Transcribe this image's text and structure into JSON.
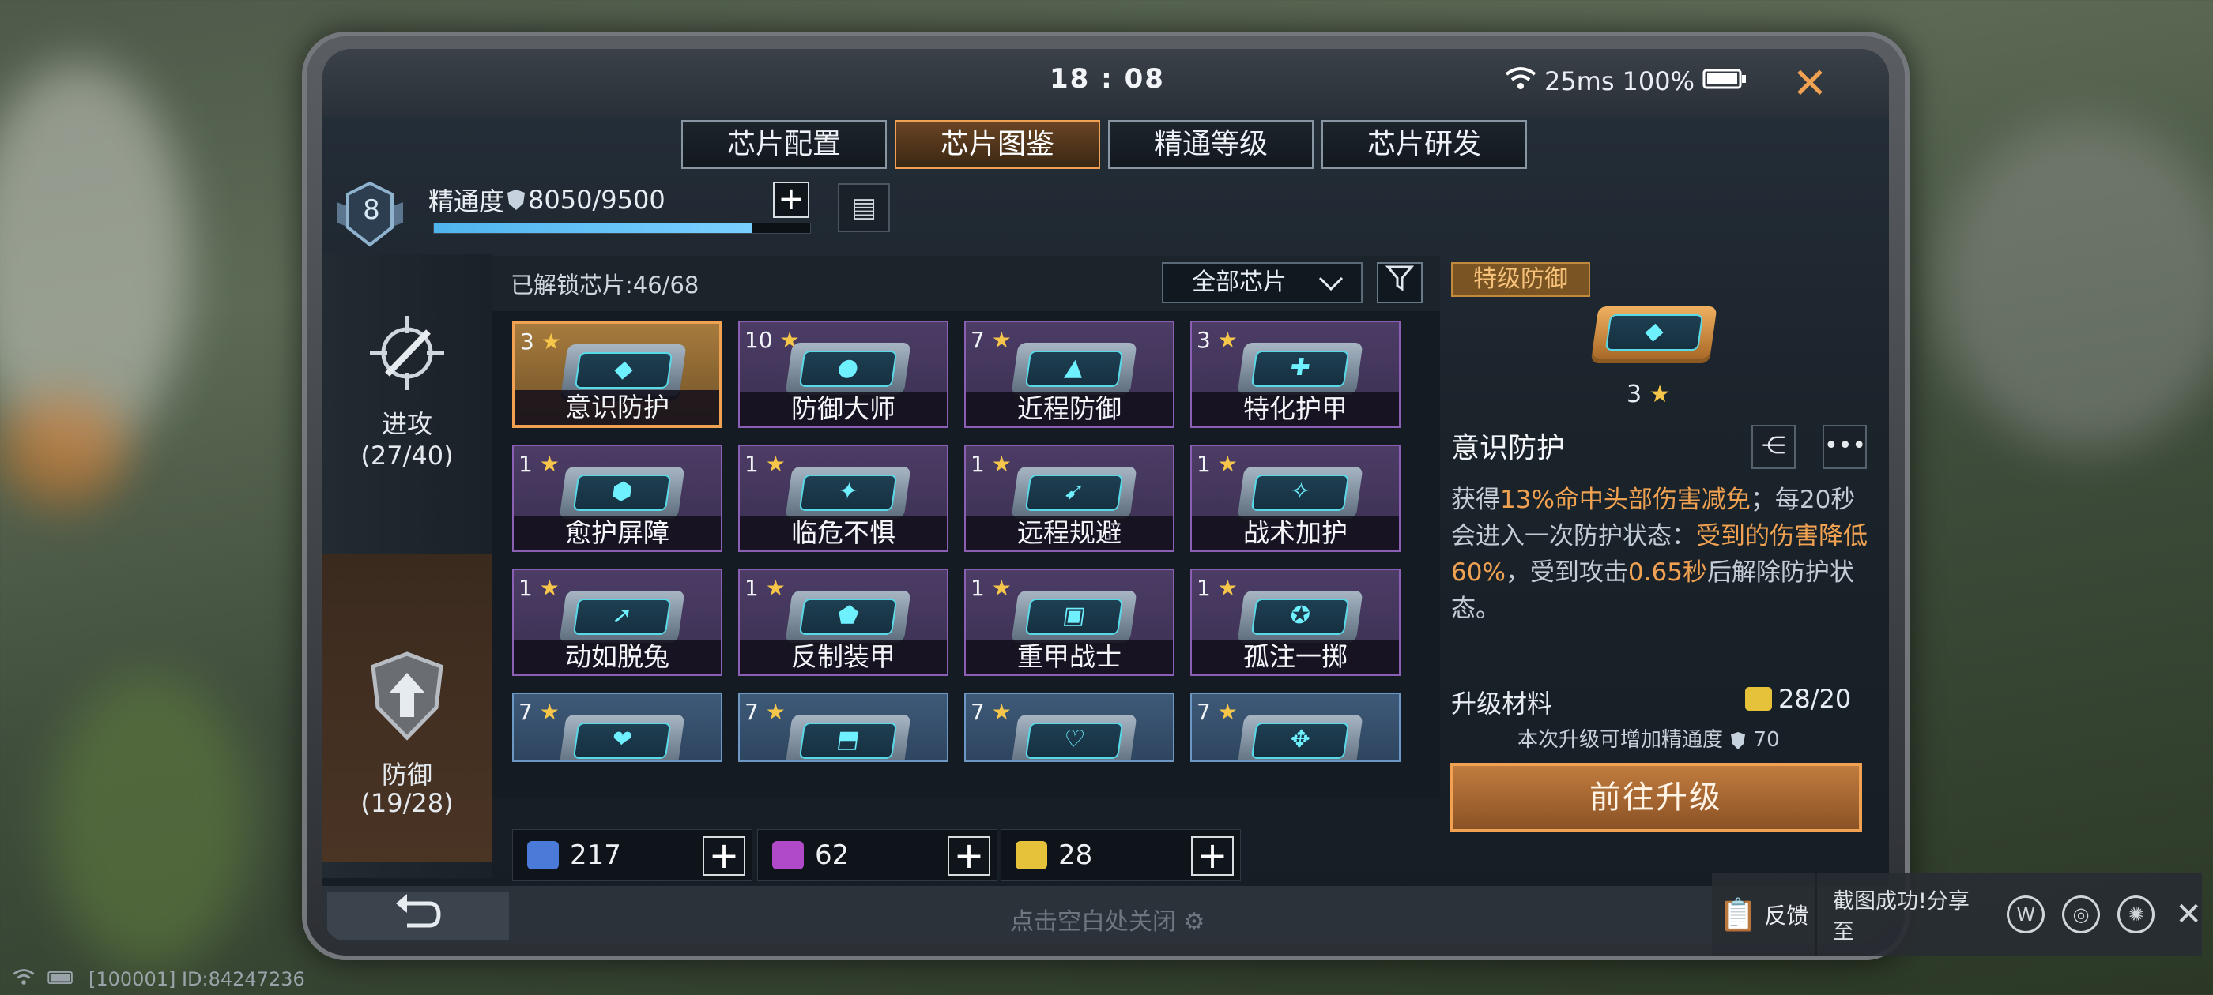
{
  "status": {
    "time": "18 : 08",
    "ping": "25ms",
    "battery": "100%"
  },
  "tabs": [
    {
      "label": "芯片配置",
      "active": false
    },
    {
      "label": "芯片图鉴",
      "active": true
    },
    {
      "label": "精通等级",
      "active": false
    },
    {
      "label": "芯片研发",
      "active": false
    }
  ],
  "mastery": {
    "level": "8",
    "label": "精通度",
    "value": "8050/9500",
    "progress": 0.847
  },
  "sidebar": [
    {
      "label": "进攻",
      "count": "(27/40)",
      "icon": "crosshair-sword-icon"
    },
    {
      "label": "防御",
      "count": "(19/28)",
      "icon": "shield-arrow-icon"
    }
  ],
  "grid": {
    "unlocked": "已解锁芯片:46/68",
    "filter": "全部芯片",
    "cards": [
      {
        "stars": "3",
        "name": "意识防护",
        "glyph": "◆",
        "tier": "gold"
      },
      {
        "stars": "10",
        "name": "防御大师",
        "glyph": "●",
        "tier": "purple"
      },
      {
        "stars": "7",
        "name": "近程防御",
        "glyph": "▲",
        "tier": "purple"
      },
      {
        "stars": "3",
        "name": "特化护甲",
        "glyph": "✚",
        "tier": "purple"
      },
      {
        "stars": "1",
        "name": "愈护屏障",
        "glyph": "⬢",
        "tier": "purple"
      },
      {
        "stars": "1",
        "name": "临危不惧",
        "glyph": "✦",
        "tier": "purple"
      },
      {
        "stars": "1",
        "name": "远程规避",
        "glyph": "➹",
        "tier": "purple"
      },
      {
        "stars": "1",
        "name": "战术加护",
        "glyph": "✧",
        "tier": "purple"
      },
      {
        "stars": "1",
        "name": "动如脱兔",
        "glyph": "➚",
        "tier": "purple"
      },
      {
        "stars": "1",
        "name": "反制装甲",
        "glyph": "⬟",
        "tier": "purple"
      },
      {
        "stars": "1",
        "name": "重甲战士",
        "glyph": "▣",
        "tier": "purple"
      },
      {
        "stars": "1",
        "name": "孤注一掷",
        "glyph": "✪",
        "tier": "purple"
      },
      {
        "stars": "7",
        "name": "",
        "glyph": "❤",
        "tier": "blue"
      },
      {
        "stars": "7",
        "name": "",
        "glyph": "⬒",
        "tier": "blue"
      },
      {
        "stars": "7",
        "name": "",
        "glyph": "♡",
        "tier": "blue"
      },
      {
        "stars": "7",
        "name": "",
        "glyph": "✥",
        "tier": "blue"
      }
    ]
  },
  "resources": [
    {
      "value": "217",
      "color": "#4a7bd8"
    },
    {
      "value": "62",
      "color": "#b04ac8"
    },
    {
      "value": "28",
      "color": "#e6c23a"
    }
  ],
  "detail": {
    "tag": "特级防御",
    "stars": "3",
    "title": "意识防护",
    "desc_parts": [
      {
        "t": "获得",
        "h": false
      },
      {
        "t": "13%命中头部伤害减免",
        "h": true
      },
      {
        "t": "；每20秒会进入一次防护状态：",
        "h": false
      },
      {
        "t": "受到的伤害降低60%",
        "h": true
      },
      {
        "t": "，受到攻击",
        "h": false
      },
      {
        "t": "0.65秒",
        "h": true
      },
      {
        "t": "后解除防护状态。",
        "h": false
      }
    ],
    "material_label": "升级材料",
    "material_count": "28/20",
    "note": "本次升级可增加精通度",
    "note_value": "70",
    "upgrade_label": "前往升级"
  },
  "bottom": {
    "hint": "点击空白处关闭"
  },
  "share": {
    "feedback": "反馈",
    "text": "截图成功!分享至"
  },
  "footer": {
    "id": "[100001] ID:84247236"
  }
}
